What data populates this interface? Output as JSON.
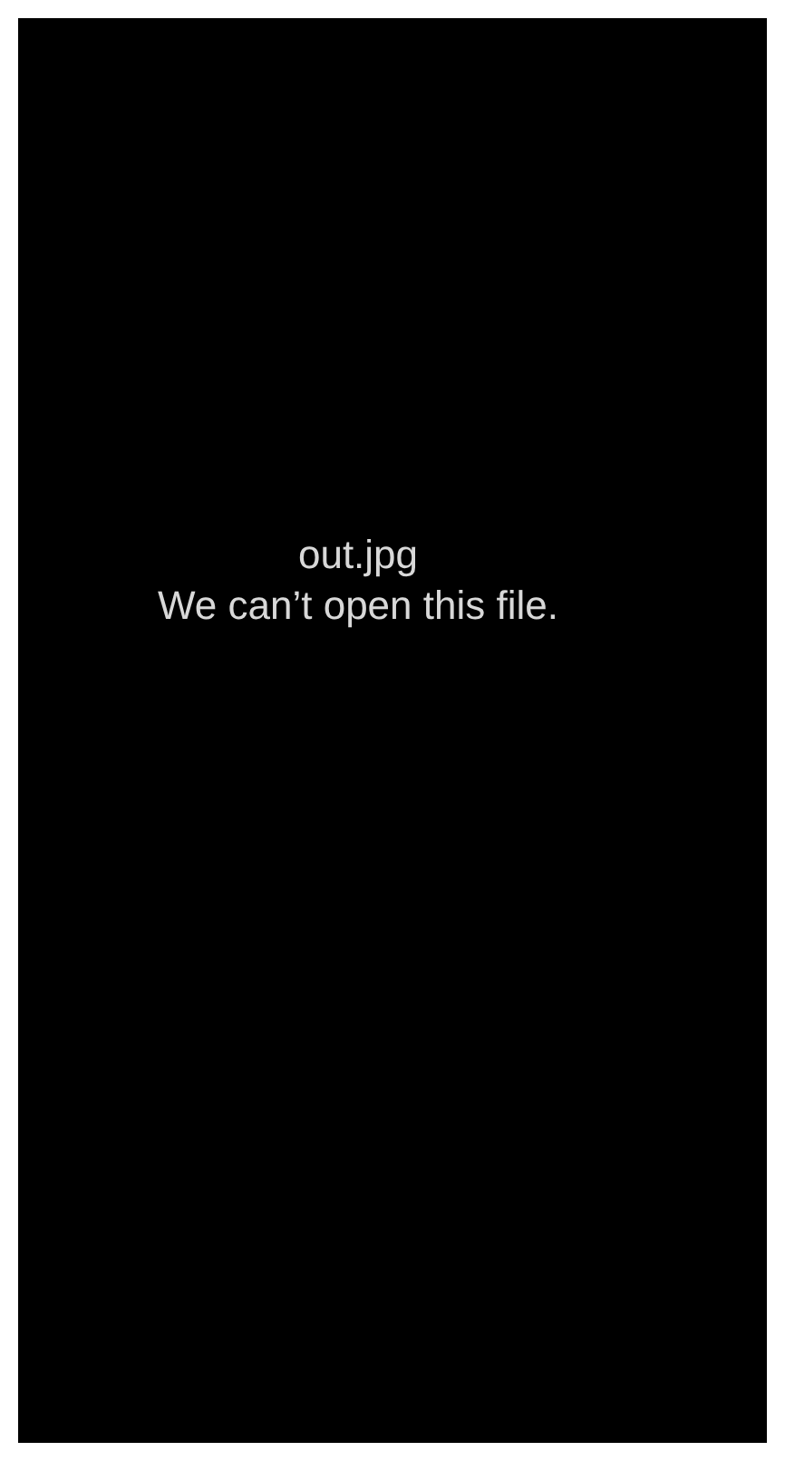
{
  "file_name": "out.jpg",
  "message": "We can’t open this file."
}
